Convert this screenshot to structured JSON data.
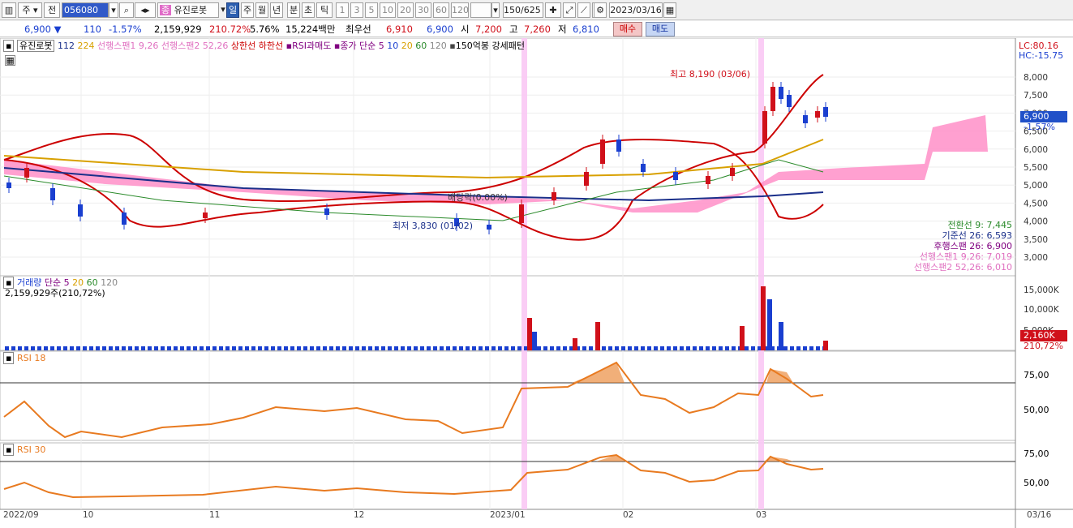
{
  "toolbar": {
    "period": "주",
    "prev": "전",
    "code": "056080",
    "name": "유진로봇",
    "tf_label": "일",
    "tabs": [
      "일",
      "주",
      "월",
      "년",
      "분",
      "초",
      "틱"
    ],
    "intervals": [
      "1",
      "3",
      "5",
      "10",
      "20",
      "30",
      "60",
      "120"
    ],
    "count": "150/625",
    "date": "2023/03/16"
  },
  "quote": {
    "price": "6,900",
    "arrow": "▼",
    "change": "110",
    "change_pct": "-1.57%",
    "volume": "2,159,929",
    "vol_ratio": "210.72%",
    "turnover": "5.76%",
    "amount": "15,224백만",
    "bid_label": "최우선",
    "bid": "6,910",
    "ask": "6,900",
    "open_label": "시",
    "open": "7,200",
    "high_label": "고",
    "high": "7,260",
    "low_label": "저",
    "low": "6,810",
    "buy": "매수",
    "sell": "매도"
  },
  "legend_main": {
    "name": "유진로봇",
    "v112": "112",
    "v224": "224",
    "span1": "선행스팬1 9,26",
    "span2": "선행스팬2 52,26",
    "upper": "상한선",
    "lower": "하한선",
    "rsi": "RSI과매도",
    "ma": "종가 단순 5",
    "ma10": "10",
    "ma20": "20",
    "ma60": "60",
    "ma120": "120",
    "pattern": "150억봉 강세패턴"
  },
  "main": {
    "lc": "LC:80.16",
    "hc": "HC:-15.75",
    "high_note": "최고 8,190 (03/06)",
    "low_note": "최저 3,830 (01/02)",
    "dividend": "배당락(0.00%)",
    "current_tag": "6,900",
    "current_pct": "-1.57%",
    "y_ticks": [
      "8,000",
      "7,500",
      "7,000",
      "6,500",
      "6,000",
      "5,500",
      "5,000",
      "4,500",
      "4,000",
      "3,500",
      "3,000"
    ],
    "ichimoku": [
      "전환선 9: 7,445",
      "기준선 26: 6,593",
      "후행스팬 26: 6,900",
      "선행스팬1 9,26: 7,019",
      "선행스팬2 52,26: 6,010"
    ]
  },
  "volume": {
    "title": "거래량",
    "ma_label": "단순 5",
    "ma20": "20",
    "ma60": "60",
    "ma120": "120",
    "value": "2,159,929주(210,72%)",
    "y_ticks": [
      "15,000K",
      "10,000K",
      "5,000K"
    ],
    "tag": "2,160K",
    "tag_pct": "210,72%"
  },
  "rsi18": {
    "title": "RSI 18",
    "y_ticks": [
      "75,00",
      "50,00"
    ]
  },
  "rsi30": {
    "title": "RSI 30",
    "y_ticks": [
      "75,00",
      "50,00"
    ]
  },
  "x_axis": [
    "2022/09",
    "10",
    "11",
    "12",
    "2023/01",
    "02",
    "03",
    "03/16"
  ],
  "colors": {
    "up": "#d0101a",
    "down": "#1a3fd0",
    "cloud": "#ff8fc8",
    "highlight": "#f9c8f4",
    "rsi": "#e87a20"
  }
}
